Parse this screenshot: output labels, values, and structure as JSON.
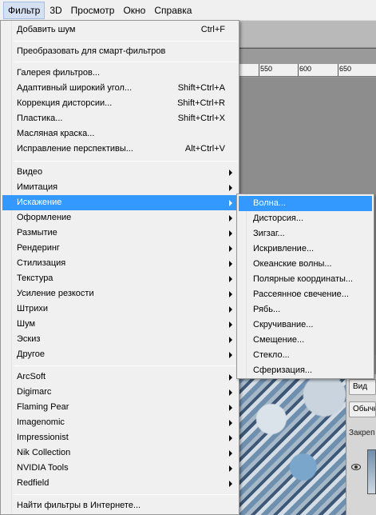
{
  "menubar": {
    "items": [
      {
        "label": "Фильтр",
        "active": true
      },
      {
        "label": "3D",
        "active": false
      },
      {
        "label": "Просмотр",
        "active": false
      },
      {
        "label": "Окно",
        "active": false
      },
      {
        "label": "Справка",
        "active": false
      }
    ]
  },
  "ruler": {
    "labels": [
      "550",
      "600",
      "650"
    ]
  },
  "panel": {
    "button1": "Вид",
    "button2": "Обычн",
    "label": "Закреп"
  },
  "filter_menu": {
    "items": [
      {
        "label": "Добавить шум",
        "shortcut": "Ctrl+F"
      },
      {
        "label": "Преобразовать для смарт-фильтров"
      },
      {
        "label": "Галерея фильтров..."
      },
      {
        "label": "Адаптивный широкий угол...",
        "shortcut": "Shift+Ctrl+A"
      },
      {
        "label": "Коррекция дисторсии...",
        "shortcut": "Shift+Ctrl+R"
      },
      {
        "label": "Пластика...",
        "shortcut": "Shift+Ctrl+X"
      },
      {
        "label": "Масляная краска..."
      },
      {
        "label": "Исправление перспективы...",
        "shortcut": "Alt+Ctrl+V"
      },
      {
        "label": "Видео"
      },
      {
        "label": "Имитация"
      },
      {
        "label": "Искажение"
      },
      {
        "label": "Оформление"
      },
      {
        "label": "Размытие"
      },
      {
        "label": "Рендеринг"
      },
      {
        "label": "Стилизация"
      },
      {
        "label": "Текстура"
      },
      {
        "label": "Усиление резкости"
      },
      {
        "label": "Штрихи"
      },
      {
        "label": "Шум"
      },
      {
        "label": "Эскиз"
      },
      {
        "label": "Другое"
      },
      {
        "label": "ArcSoft"
      },
      {
        "label": "Digimarc"
      },
      {
        "label": "Flaming Pear"
      },
      {
        "label": "Imagenomic"
      },
      {
        "label": "Impressionist"
      },
      {
        "label": "Nik Collection"
      },
      {
        "label": "NVIDIA Tools"
      },
      {
        "label": "Redfield"
      },
      {
        "label": "Найти фильтры в Интернете..."
      }
    ]
  },
  "distort_submenu": {
    "items": [
      {
        "label": "Волна..."
      },
      {
        "label": "Дисторсия..."
      },
      {
        "label": "Зигзаг..."
      },
      {
        "label": "Искривление..."
      },
      {
        "label": "Океанские волны..."
      },
      {
        "label": "Полярные координаты..."
      },
      {
        "label": "Рассеянное свечение..."
      },
      {
        "label": "Рябь..."
      },
      {
        "label": "Скручивание..."
      },
      {
        "label": "Смещение..."
      },
      {
        "label": "Стекло..."
      },
      {
        "label": "Сферизация..."
      }
    ]
  },
  "colors": {
    "highlight": "#3399ff",
    "menu_bg": "#f0f0f0",
    "active_menubar": "#d5e1f2"
  }
}
